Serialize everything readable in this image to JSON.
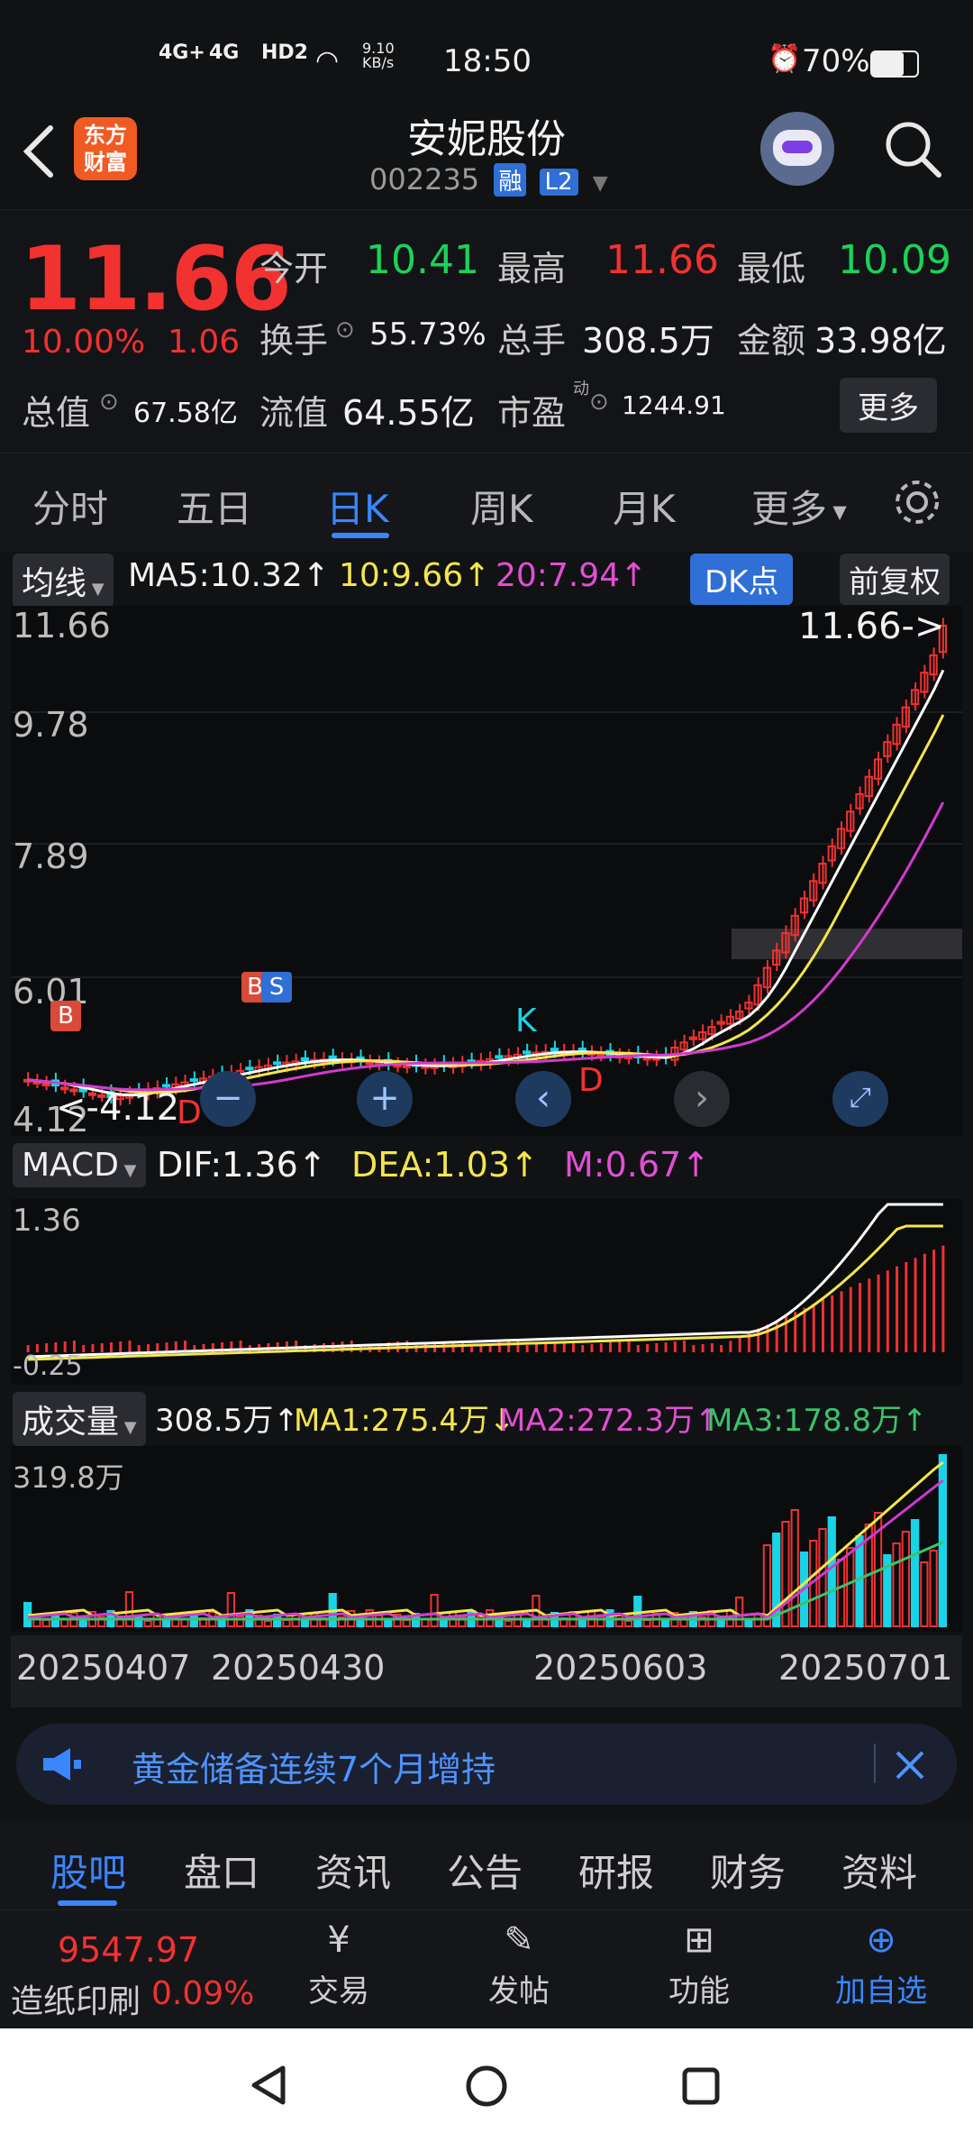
{
  "status_bar": {
    "net1": "4G+",
    "net2": "4G",
    "hd": "HD2",
    "speed_value": "9.10",
    "speed_unit": "KB/s",
    "time": "18:50",
    "battery": "70%"
  },
  "header": {
    "back_icon": "chevron-left-icon",
    "logo_line1": "东方",
    "logo_line2": "财富",
    "stock_name": "安妮股份",
    "stock_code": "002235",
    "badge_margin": "融",
    "badge_level": "L2"
  },
  "quote": {
    "price": "11.66",
    "change_pct": "10.00%",
    "change_abs": "1.06",
    "open_label": "今开",
    "open": "10.41",
    "high_label": "最高",
    "high": "11.66",
    "low_label": "最低",
    "low": "10.09",
    "turnover_label": "换手",
    "turnover": "55.73%",
    "volume_label": "总手",
    "volume": "308.5万",
    "amount_label": "金额",
    "amount": "33.98亿",
    "mktcap_label": "总值",
    "mktcap": "67.58亿",
    "float_label": "流值",
    "float": "64.55亿",
    "pe_label": "市盈",
    "pe_sup": "动",
    "pe": "1244.91",
    "more": "更多"
  },
  "tabs": [
    "分时",
    "五日",
    "日K",
    "周K",
    "月K",
    "更多"
  ],
  "tabs_active_index": 2,
  "main_chart": {
    "indicator_label": "均线",
    "ma5": "MA5:10.32↑",
    "ma10": "10:9.66↑",
    "ma20": "20:7.94↑",
    "dk_button": "DK点",
    "adjust_button": "前复权",
    "y_ticks": [
      "11.66",
      "9.78",
      "7.89",
      "6.01",
      "4.12"
    ],
    "high_marker": "11.66->",
    "low_marker": "<-4.12",
    "signal_b": "B",
    "signal_s": "S",
    "signal_k": "K",
    "signal_d": "D",
    "colors": {
      "up": "#f23131",
      "down": "#19d3e6",
      "ma5": "#ffffff",
      "ma10": "#f3e64b",
      "ma20": "#d23ad0"
    }
  },
  "macd": {
    "label": "MACD",
    "dif": "DIF:1.36↑",
    "dea": "DEA:1.03↑",
    "m": "M:0.67↑",
    "y_top": "1.36",
    "y_bottom": "-0.25"
  },
  "volume": {
    "label": "成交量",
    "vol": "308.5万↑",
    "ma1": "MA1:275.4万↓",
    "ma2": "MA2:272.3万↑",
    "ma3": "MA3:178.8万↑",
    "y_top": "319.8万",
    "dates": [
      "20250407",
      "20250430",
      "20250603",
      "20250701"
    ]
  },
  "news": {
    "text": "黄金储备连续7个月增持"
  },
  "bottom_tabs": [
    "股吧",
    "盘口",
    "资讯",
    "公告",
    "研报",
    "财务",
    "资料"
  ],
  "bottom_tabs_active_index": 0,
  "footer": {
    "index_value": "9547.97",
    "index_name": "造纸印刷",
    "index_change": "0.09%",
    "trade": "交易",
    "post": "发帖",
    "function": "功能",
    "add_watch": "加自选"
  }
}
